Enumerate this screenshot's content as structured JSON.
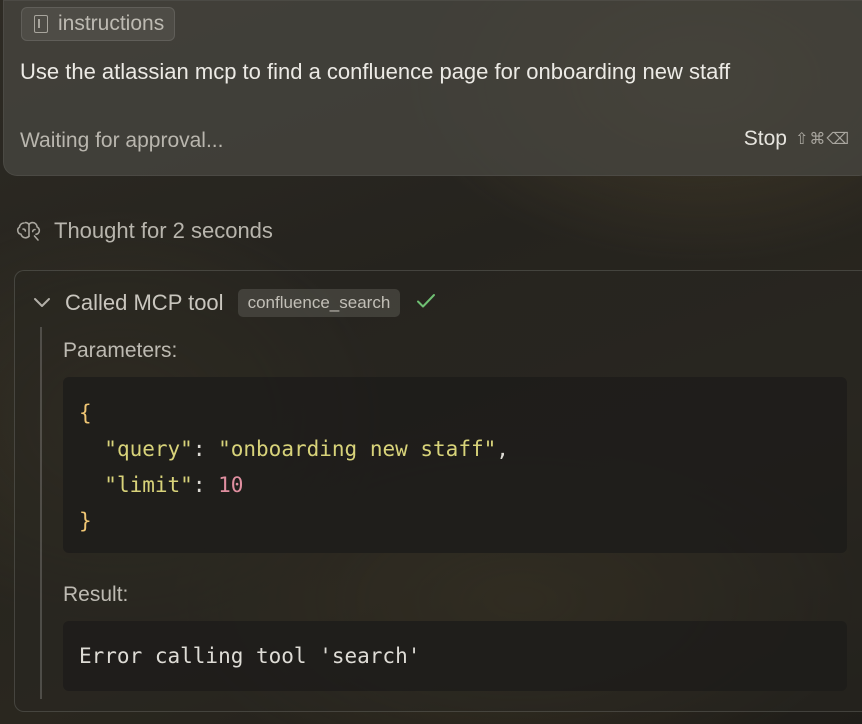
{
  "composer": {
    "chip_label": "instructions",
    "chip_icon": "book-icon",
    "prompt": "Use the atlassian mcp to find a confluence page for onboarding new staff",
    "status": "Waiting for approval...",
    "stop_label": "Stop",
    "stop_shortcut": "⇧⌘⌫"
  },
  "thought": {
    "icon": "brain-icon",
    "text": "Thought for 2 seconds"
  },
  "tool_call": {
    "title": "Called MCP tool",
    "tool_name": "confluence_search",
    "status": "success",
    "parameters_label": "Parameters:",
    "parameters": {
      "open": "{",
      "close": "}",
      "query_key": "\"query\"",
      "query_value": "\"onboarding new staff\"",
      "limit_key": "\"limit\"",
      "limit_value": "10"
    },
    "result_label": "Result:",
    "result_text": "Error calling tool 'search'"
  },
  "colors": {
    "accent_success": "#6fbf73",
    "json_key": "#d8d37a",
    "json_number": "#e08fa0",
    "json_brace": "#f0c674"
  }
}
